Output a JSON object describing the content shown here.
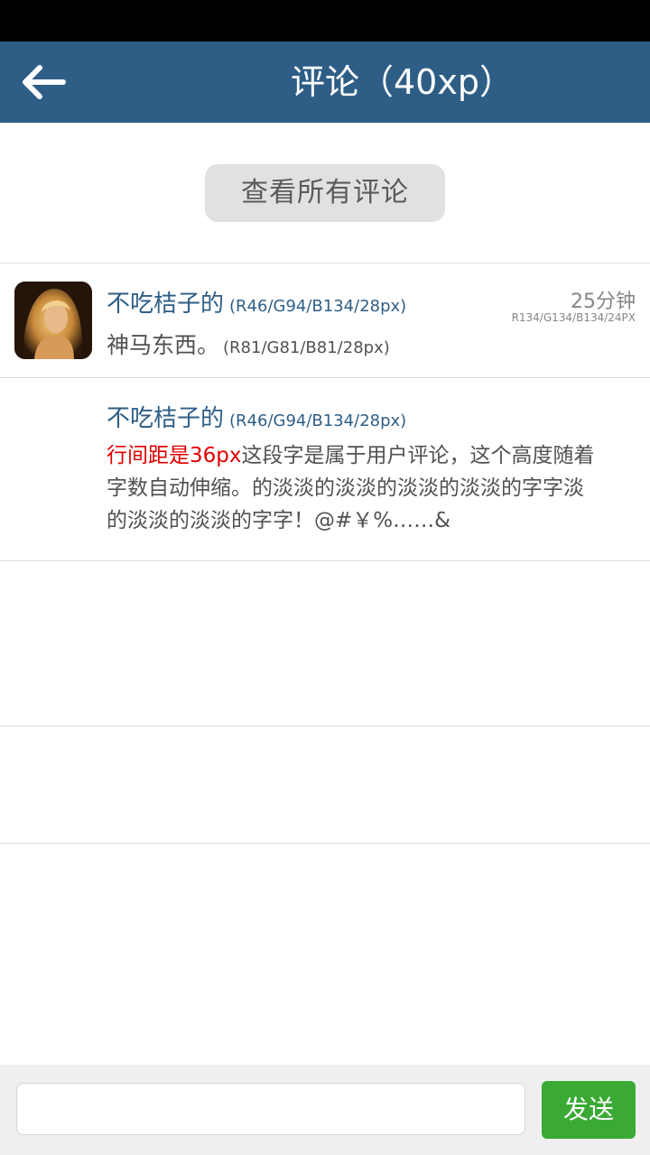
{
  "header": {
    "title": "评论（40xp）",
    "back_icon": "arrow-left-icon",
    "bar_color": "#2e5e86"
  },
  "view_all": {
    "label": "查看所有评论"
  },
  "comments": [
    {
      "username": "不吃桔子的",
      "username_spec": "(R46/G94/B134/28px)",
      "text": "神马东西。",
      "text_spec": "(R81/G81/B81/28px)",
      "time": "25分钟",
      "time_spec": "R134/G134/B134/24PX"
    },
    {
      "username": "不吃桔子的",
      "username_spec": "(R46/G94/B134/28px)",
      "text_red": "行间距是36px",
      "text_line1": "这段字是属于用户评论，这个高度随着",
      "text_line2": "字数自动伸缩。的淡淡的淡淡的淡淡的淡淡的字字淡",
      "text_line3": "的淡淡的淡淡的字字！@#￥%……&"
    }
  ],
  "composer": {
    "input_value": "",
    "input_placeholder": "",
    "send_label": "发送",
    "send_color": "#3aaa35"
  },
  "colors": {
    "name": "#2e5e86",
    "body_text": "#515151",
    "time": "#868686",
    "highlight": "#e00000"
  }
}
